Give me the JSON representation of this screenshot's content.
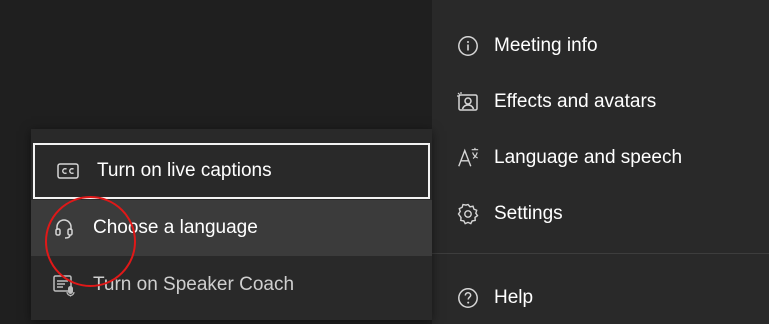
{
  "menu": {
    "items": [
      {
        "label": "Meeting info",
        "icon": "info-icon"
      },
      {
        "label": "Effects and avatars",
        "icon": "effects-avatar-icon"
      },
      {
        "label": "Language and speech",
        "icon": "language-icon"
      },
      {
        "label": "Settings",
        "icon": "gear-icon"
      },
      {
        "label": "Help",
        "icon": "help-icon"
      }
    ]
  },
  "submenu": {
    "items": [
      {
        "label": "Turn on live captions",
        "icon": "closed-captions-icon"
      },
      {
        "label": "Choose a language",
        "icon": "headset-icon"
      },
      {
        "label": "Turn on Speaker Coach",
        "icon": "speaker-coach-icon"
      }
    ]
  },
  "colors": {
    "background": "#1f1f1f",
    "menu_background": "#292929",
    "hover_background": "#3b3b3b",
    "annotation": "#e01818"
  }
}
